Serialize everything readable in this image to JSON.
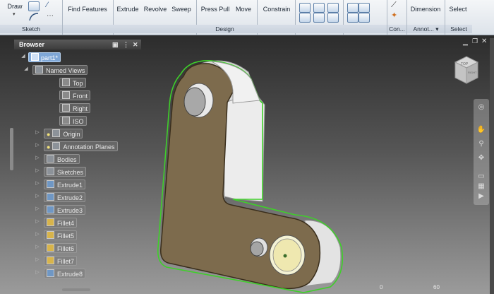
{
  "ribbon": {
    "buttons": {
      "draw": "Draw",
      "find_features": "Find Features",
      "extrude": "Extrude",
      "revolve": "Revolve",
      "sweep": "Sweep",
      "press_pull": "Press Pull",
      "move": "Move",
      "constrain": "Constrain",
      "dimension": "Dimension",
      "select": "Select"
    },
    "panels": {
      "sketch": "Sketch",
      "design": "Design",
      "constrain": "Con...",
      "annotate": "Annot...",
      "select": "Select"
    },
    "annotate_dropdown": "▾"
  },
  "browser": {
    "title": "Browser",
    "root": "part1*",
    "items": [
      {
        "label": "Named Views"
      },
      {
        "label": "Top"
      },
      {
        "label": "Front"
      },
      {
        "label": "Right"
      },
      {
        "label": "ISO"
      },
      {
        "label": "Origin"
      },
      {
        "label": "Annotation Planes"
      },
      {
        "label": "Bodies"
      },
      {
        "label": "Sketches"
      },
      {
        "label": "Extrude1"
      },
      {
        "label": "Extrude2"
      },
      {
        "label": "Extrude3"
      },
      {
        "label": "Fillet4"
      },
      {
        "label": "Fillet5"
      },
      {
        "label": "Fillet6"
      },
      {
        "label": "Fillet7"
      },
      {
        "label": "Extrude8"
      }
    ]
  },
  "viewcube": {
    "top": "TOP",
    "right": "RIGHT"
  },
  "ruler": {
    "tick0": "0",
    "tick1": "60"
  },
  "colors": {
    "part_face": "#7d6b4d",
    "part_side": "#d8d8d8",
    "selection_edge": "#3fcf2a",
    "tree_root": "#7fa7d6"
  },
  "icons": {
    "close": "close-icon",
    "pin": "pin-icon",
    "menu": "menu-icon"
  }
}
